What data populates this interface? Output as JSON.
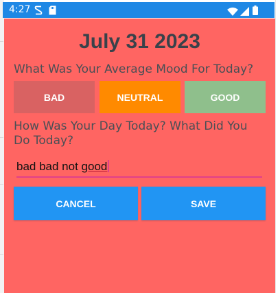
{
  "status_bar": {
    "time": "4:27",
    "icons": [
      "sim-icon",
      "sd-card-icon",
      "wifi-icon",
      "signal-icon",
      "battery-icon"
    ],
    "color": "#1e88e5"
  },
  "dialog": {
    "date": "July 31 2023",
    "mood_question": "What Was Your Average Mood For Today?",
    "mood_options": [
      {
        "label": "BAD",
        "color": "#d96262"
      },
      {
        "label": "NEUTRAL",
        "color": "#ff8a00"
      },
      {
        "label": "GOOD",
        "color": "#8fbf8c"
      }
    ],
    "day_question": "How Was Your Day Today? What Did You Do Today?",
    "entry_text_plain": "bad bad not ",
    "entry_text_flagged": "good",
    "cancel_label": "CANCEL",
    "save_label": "SAVE",
    "background_color": "#ff6562",
    "button_color": "#2195f3"
  }
}
